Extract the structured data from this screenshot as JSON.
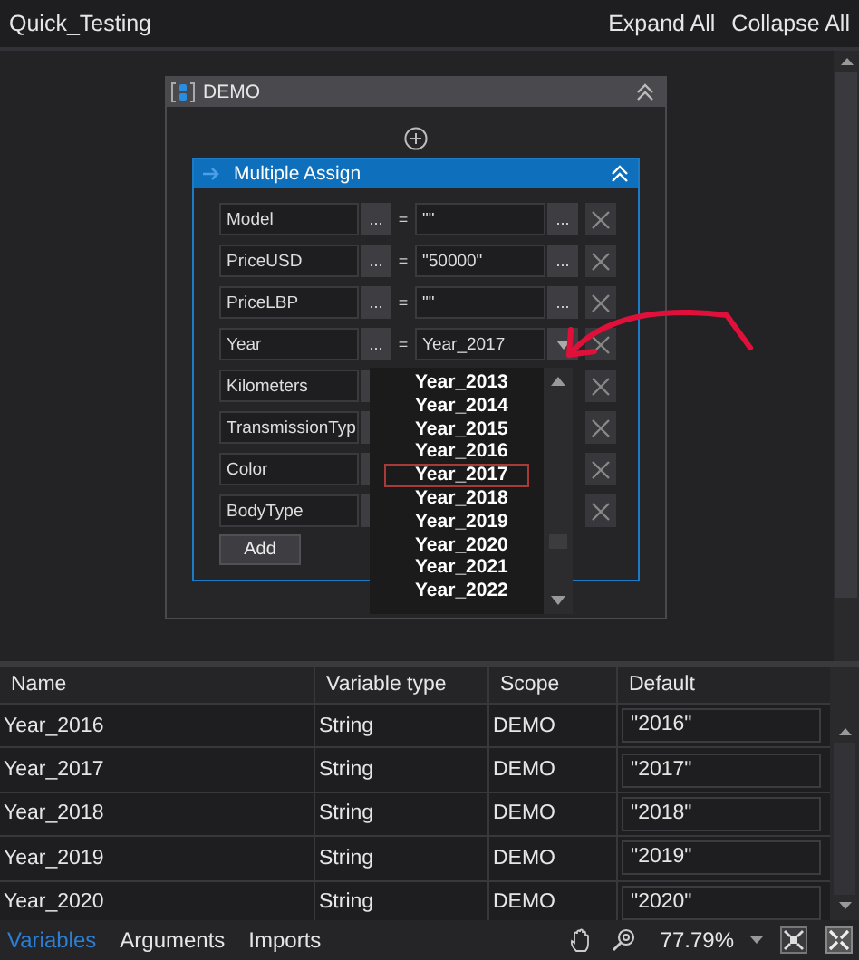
{
  "header": {
    "title": "Quick_Testing",
    "actions": [
      "Expand All",
      "Collapse All"
    ]
  },
  "sequence": {
    "title": "DEMO"
  },
  "multiple_assign": {
    "title": "Multiple Assign",
    "rows": [
      {
        "kind": "value",
        "target": "Model",
        "target_button": "...",
        "operator": "=",
        "value": "\"\"",
        "value_button": "..."
      },
      {
        "kind": "value",
        "target": "PriceUSD",
        "target_button": "...",
        "operator": "=",
        "value": "\"50000\"",
        "value_button": "..."
      },
      {
        "kind": "value",
        "target": "PriceLBP",
        "target_button": "...",
        "operator": "=",
        "value": "\"\"",
        "value_button": "..."
      },
      {
        "kind": "dropdown",
        "target": "Year",
        "target_button": "...",
        "operator": "=",
        "value": "Year_2017"
      },
      {
        "kind": "covered",
        "target": "Kilometers"
      },
      {
        "kind": "covered",
        "target": "TransmissionTyp"
      },
      {
        "kind": "covered",
        "target": "Color"
      },
      {
        "kind": "covered",
        "target": "BodyType"
      }
    ],
    "add_button": "Add"
  },
  "dropdown": {
    "items": [
      {
        "label": "Year_2013",
        "selected": false
      },
      {
        "label": "Year_2014",
        "selected": false
      },
      {
        "label": "Year_2015",
        "selected": false
      },
      {
        "label": "Year_2016",
        "selected": false
      },
      {
        "label": "Year_2017",
        "selected": true
      },
      {
        "label": "Year_2018",
        "selected": false
      },
      {
        "label": "Year_2019",
        "selected": false
      },
      {
        "label": "Year_2020",
        "selected": false
      },
      {
        "label": "Year_2021",
        "selected": false
      },
      {
        "label": "Year_2022",
        "selected": false
      }
    ]
  },
  "variables_table": {
    "columns": [
      "Name",
      "Variable type",
      "Scope",
      "Default"
    ],
    "rows": [
      [
        "Year_2016",
        "String",
        "DEMO",
        "\"2016\""
      ],
      [
        "Year_2017",
        "String",
        "DEMO",
        "\"2017\""
      ],
      [
        "Year_2018",
        "String",
        "DEMO",
        "\"2018\""
      ],
      [
        "Year_2019",
        "String",
        "DEMO",
        "\"2019\""
      ],
      [
        "Year_2020",
        "String",
        "DEMO",
        "\"2020\""
      ]
    ]
  },
  "bottom_bar": {
    "tabs": [
      {
        "label": "Variables",
        "selected": true
      },
      {
        "label": "Arguments",
        "selected": false
      },
      {
        "label": "Imports",
        "selected": false
      }
    ],
    "zoom": "77.79%"
  }
}
